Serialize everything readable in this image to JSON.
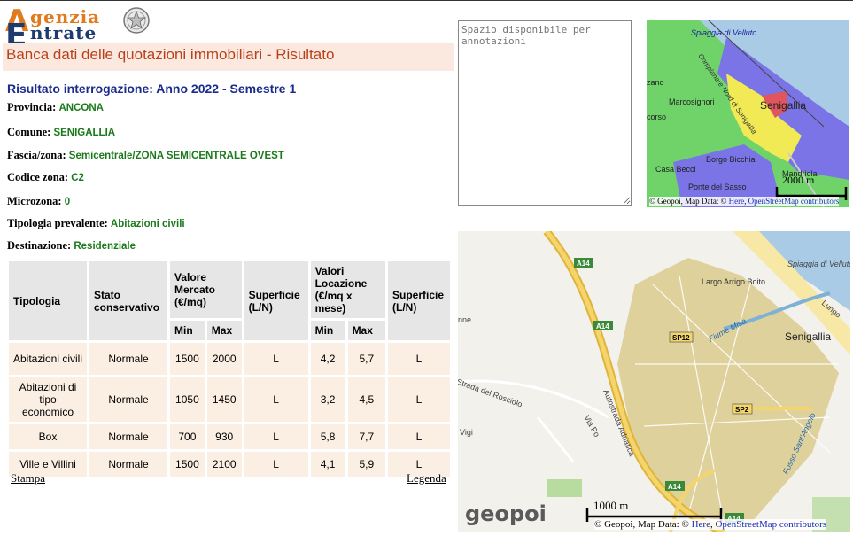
{
  "logo": {
    "line1": "genzia",
    "line2": "ntrate",
    "cap1": "A",
    "cap2": "E"
  },
  "page_title": "Banca dati delle quotazioni immobiliari - Risultato",
  "subtitle": "Risultato interrogazione: Anno 2022 - Semestre 1",
  "fields": [
    {
      "label": "Provincia:",
      "value": "ANCONA"
    },
    {
      "label": "Comune:",
      "value": "SENIGALLIA"
    },
    {
      "label": "Fascia/zona:",
      "value": "Semicentrale/ZONA SEMICENTRALE OVEST"
    },
    {
      "label": "Codice zona:",
      "value": "C2"
    },
    {
      "label": "Microzona:",
      "value": "0"
    },
    {
      "label": "Tipologia prevalente:",
      "value": "Abitazioni civili"
    },
    {
      "label": "Destinazione:",
      "value": "Residenziale"
    }
  ],
  "table": {
    "headers": {
      "tipologia": "Tipologia",
      "stato": "Stato conservativo",
      "valore": "Valore Mercato (€/mq)",
      "superficie1": "Superficie (L/N)",
      "locazione": "Valori Locazione (€/mq x mese)",
      "superficie2": "Superficie (L/N)",
      "min": "Min",
      "max": "Max"
    },
    "rows": [
      {
        "tipologia": "Abitazioni civili",
        "stato": "Normale",
        "vmin": "1500",
        "vmax": "2000",
        "s1": "L",
        "lmin": "4,2",
        "lmax": "5,7",
        "s2": "L"
      },
      {
        "tipologia": "Abitazioni di tipo economico",
        "stato": "Normale",
        "vmin": "1050",
        "vmax": "1450",
        "s1": "L",
        "lmin": "3,2",
        "lmax": "4,5",
        "s2": "L"
      },
      {
        "tipologia": "Box",
        "stato": "Normale",
        "vmin": "700",
        "vmax": "930",
        "s1": "L",
        "lmin": "5,8",
        "lmax": "7,7",
        "s2": "L"
      },
      {
        "tipologia": "Ville e Villini",
        "stato": "Normale",
        "vmin": "1500",
        "vmax": "2100",
        "s1": "L",
        "lmin": "4,1",
        "lmax": "5,9",
        "s2": "L"
      }
    ]
  },
  "links": {
    "stampa": "Stampa",
    "legenda": "Legenda"
  },
  "notes_placeholder": "Spazio disponibile per annotazioni",
  "map1": {
    "labels": {
      "spiaggia": "Spiaggia di Velluto",
      "complanare": "Complanare Nord di Senigallia",
      "senigallia": "Senigallia",
      "marcosignori": "Marcosignori",
      "zano": "zano",
      "corso": "corso",
      "borgo": "Borgo Bicchia",
      "casa": "Casa Becci",
      "mandriola": "Mandriola",
      "ponte": "Ponte del Sasso"
    },
    "scale": "2000 m",
    "attribution_prefix": "© Geopoi, Map Data: © ",
    "attribution_here": "Here",
    "attribution_osm": "OpenStreetMap contributors",
    "colors": {
      "green": "#6fd36a",
      "blue": "#7a74e6",
      "yellow": "#f2ea55",
      "red": "#e0555e",
      "sea": "#a9cbe6"
    }
  },
  "map2": {
    "labels": {
      "spiaggia": "Spiaggia di Velluto",
      "largo": "Largo Arrigo Boito",
      "fiume": "Fiume Misa",
      "senigallia": "Senigallia",
      "strada": "Strada del Rosciolo",
      "vigi": "Vigi",
      "viapo": "Via Po",
      "autostrada": "Autostrada Adriatica",
      "fosso": "Fosso Sant'Angelo",
      "lungo": "Lungo",
      "nne": "nne"
    },
    "road_shields": [
      "A14",
      "A14",
      "SP12",
      "SP2",
      "A14",
      "A14"
    ],
    "brand": "geopoi",
    "scale": "1000 m",
    "attribution_prefix": "© Geopoi, Map Data: © ",
    "attribution_here": "Here",
    "attribution_osm": "OpenStreetMap contributors"
  }
}
